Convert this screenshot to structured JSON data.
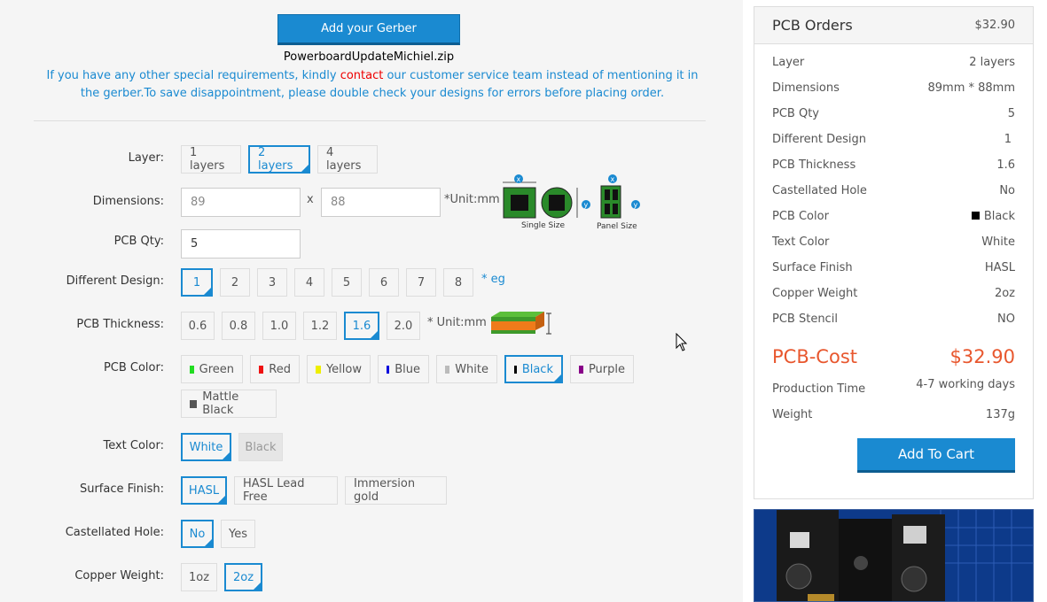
{
  "upload": {
    "button_label": "Add your Gerber",
    "filename": "PowerboardUpdateMichiel.zip"
  },
  "notice": {
    "part1": "If you have any other special requirements, kindly ",
    "link": "contact",
    "part2": " our customer service team instead of mentioning it in the gerber.To save disappointment, please double check your designs for errors before placing order."
  },
  "form": {
    "layer": {
      "label": "Layer:",
      "options": [
        "1 layers",
        "2 layers",
        "4 layers"
      ],
      "selected": "2 layers"
    },
    "dimensions": {
      "label": "Dimensions:",
      "width": "89",
      "height": "88",
      "sep": "x",
      "unit": "*Unit:mm",
      "single_size": "Single Size",
      "panel_size": "Panel Size"
    },
    "qty": {
      "label": "PCB Qty:",
      "value": "5"
    },
    "design": {
      "label": "Different Design:",
      "options": [
        "1",
        "2",
        "3",
        "4",
        "5",
        "6",
        "7",
        "8"
      ],
      "selected": "1",
      "eg": "* eg"
    },
    "thickness": {
      "label": "PCB Thickness:",
      "options": [
        "0.6",
        "0.8",
        "1.0",
        "1.2",
        "1.6",
        "2.0"
      ],
      "selected": "1.6",
      "unit": "* Unit:mm"
    },
    "color": {
      "label": "PCB Color:",
      "options": [
        {
          "name": "Green",
          "swatch": "#22dd22"
        },
        {
          "name": "Red",
          "swatch": "#ee1111"
        },
        {
          "name": "Yellow",
          "swatch": "#eeee00"
        },
        {
          "name": "Blue",
          "swatch": "#0000dd"
        },
        {
          "name": "White",
          "swatch": "#bbbbbb"
        },
        {
          "name": "Black",
          "swatch": "#000000"
        },
        {
          "name": "Purple",
          "swatch": "#880088"
        },
        {
          "name": "Mattle Black",
          "swatch": "#555555"
        }
      ],
      "selected": "Black"
    },
    "text_color": {
      "label": "Text Color:",
      "options": [
        "White",
        "Black"
      ],
      "selected": "White"
    },
    "finish": {
      "label": "Surface Finish:",
      "options": [
        "HASL",
        "HASL Lead Free",
        "Immersion gold"
      ],
      "selected": "HASL"
    },
    "castellated": {
      "label": "Castellated Hole:",
      "options": [
        "No",
        "Yes"
      ],
      "selected": "No"
    },
    "copper": {
      "label": "Copper Weight:",
      "options": [
        "1oz",
        "2oz"
      ],
      "selected": "2oz"
    }
  },
  "summary": {
    "title": "PCB Orders",
    "price": "$32.90",
    "rows": [
      {
        "k": "Layer",
        "v": "2 layers"
      },
      {
        "k": "Dimensions",
        "v": "89mm * 88mm"
      },
      {
        "k": "PCB Qty",
        "v": "5"
      },
      {
        "k": "Different Design",
        "v": "1"
      },
      {
        "k": "PCB Thickness",
        "v": "1.6"
      },
      {
        "k": "Castellated Hole",
        "v": "No"
      },
      {
        "k": "PCB Color",
        "v": "Black"
      },
      {
        "k": "Text Color",
        "v": "White"
      },
      {
        "k": "Surface Finish",
        "v": "HASL"
      },
      {
        "k": "Copper Weight",
        "v": "2oz"
      },
      {
        "k": "PCB Stencil",
        "v": "NO"
      }
    ],
    "cost_label": "PCB-Cost",
    "cost_value": "$32.90",
    "production_label": "Production Time",
    "production_value": "4-7 working days",
    "weight_label": "Weight",
    "weight_value": "137g",
    "cart_label": "Add To Cart",
    "accent": "#e8572e",
    "brand": "#1a8ad1"
  }
}
